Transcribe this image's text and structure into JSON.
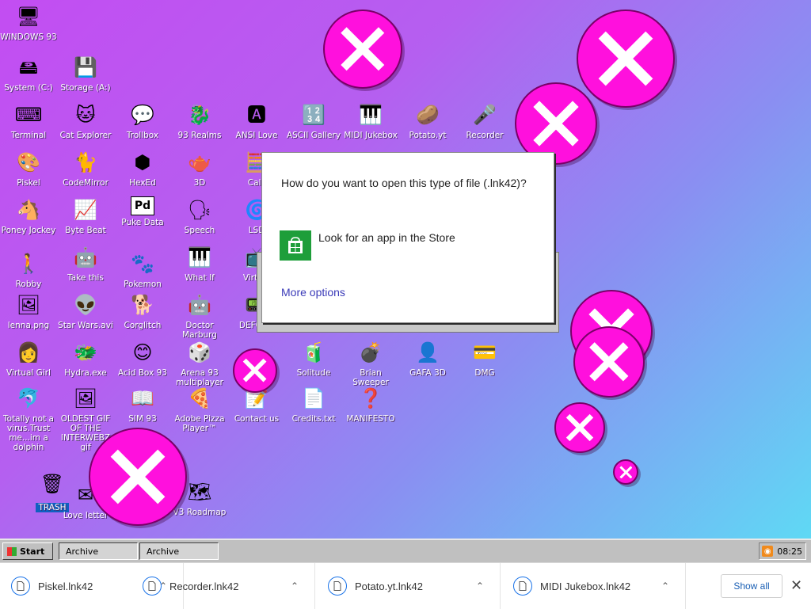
{
  "desktop": {
    "icons": [
      {
        "label": "WINDOWS 93",
        "glyph": "🖥"
      },
      {
        "label": "System (C:)",
        "glyph": "🖴"
      },
      {
        "label": "Storage (A:)",
        "glyph": "💾"
      },
      {
        "label": "Terminal",
        "glyph": "⌨"
      },
      {
        "label": "Cat Explorer",
        "glyph": "🐱"
      },
      {
        "label": "Trollbox",
        "glyph": "💬"
      },
      {
        "label": "93 Realms",
        "glyph": "🐉"
      },
      {
        "label": "ANSI Love",
        "glyph": "🅰"
      },
      {
        "label": "ASCII Gallery",
        "glyph": "🔢"
      },
      {
        "label": "MIDI Jukebox",
        "glyph": "🎹"
      },
      {
        "label": "Potato.yt",
        "glyph": "🥔"
      },
      {
        "label": "Recorder",
        "glyph": "🎤"
      },
      {
        "label": "Piskel",
        "glyph": "🎨"
      },
      {
        "label": "CodeMirror",
        "glyph": "🐈"
      },
      {
        "label": "HexEd",
        "glyph": "⬢"
      },
      {
        "label": "3D",
        "glyph": "🫖"
      },
      {
        "label": "Calc",
        "glyph": "🧮"
      },
      {
        "label": "Poney Jockey",
        "glyph": "🐴"
      },
      {
        "label": "Byte Beat",
        "glyph": "📈"
      },
      {
        "label": "Puke Data",
        "glyph": "Pd"
      },
      {
        "label": "Speech",
        "glyph": "🗣"
      },
      {
        "label": "LSD",
        "glyph": "🌀"
      },
      {
        "label": "Robby",
        "glyph": "🚶"
      },
      {
        "label": "Take this",
        "glyph": "🤖"
      },
      {
        "label": "Pokemon",
        "glyph": "🐾"
      },
      {
        "label": "What If",
        "glyph": "🎹"
      },
      {
        "label": "Virtual",
        "glyph": "📺"
      },
      {
        "label": "lenna.png",
        "glyph": "🖼"
      },
      {
        "label": "Star Wars.avi",
        "glyph": "👽"
      },
      {
        "label": "Corglitch",
        "glyph": "🐕"
      },
      {
        "label": "Doctor Marburg",
        "glyph": "🤖"
      },
      {
        "label": "DEFCON",
        "glyph": "📟"
      },
      {
        "label": "Virtual Girl",
        "glyph": "👩"
      },
      {
        "label": "Hydra.exe",
        "glyph": "🐲"
      },
      {
        "label": "Acid Box 93",
        "glyph": "😊"
      },
      {
        "label": "Arena 93 multiplayer",
        "glyph": "🎲"
      },
      {
        "label": "Solitude",
        "glyph": "🧃"
      },
      {
        "label": "Brian Sweeper",
        "glyph": "💣"
      },
      {
        "label": "GAFA 3D",
        "glyph": "👤"
      },
      {
        "label": "DMG",
        "glyph": "💳"
      },
      {
        "label": "Totally not a virus.Trust me...im a dolphin",
        "glyph": "🐬"
      },
      {
        "label": "OLDEST GIF OF THE INTERWEBZ gif",
        "glyph": "🖼"
      },
      {
        "label": "SIM 93",
        "glyph": "📖"
      },
      {
        "label": "Adobe Pizza Player™",
        "glyph": "🍕"
      },
      {
        "label": "Contact us",
        "glyph": "📝"
      },
      {
        "label": "Credits.txt",
        "glyph": "📄"
      },
      {
        "label": "MANIFESTO",
        "glyph": "❓"
      },
      {
        "label": "TRASH",
        "glyph": "🗑"
      },
      {
        "label": "Love letter",
        "glyph": "✉"
      },
      {
        "label": "V3 Roadmap",
        "glyph": "🗺"
      }
    ]
  },
  "dialog": {
    "question": "How do you want to open this type of file (.lnk42)?",
    "store_option": "Look for an app in the Store",
    "more_options": "More options"
  },
  "taskbar": {
    "start_label": "Start",
    "windows": [
      "Archive",
      "Archive"
    ],
    "clock": "08:25"
  },
  "downloads": {
    "items": [
      {
        "name": "Piskel.lnk42"
      },
      {
        "name": "Recorder.lnk42"
      },
      {
        "name": "Potato.yt.lnk42"
      },
      {
        "name": "MIDI Jukebox.lnk42"
      }
    ],
    "show_all": "Show all",
    "close": "✕"
  },
  "colors": {
    "popup_pink": "#ff10dd",
    "store_green": "#1e9e3a",
    "link_blue": "#3a3ab8"
  }
}
